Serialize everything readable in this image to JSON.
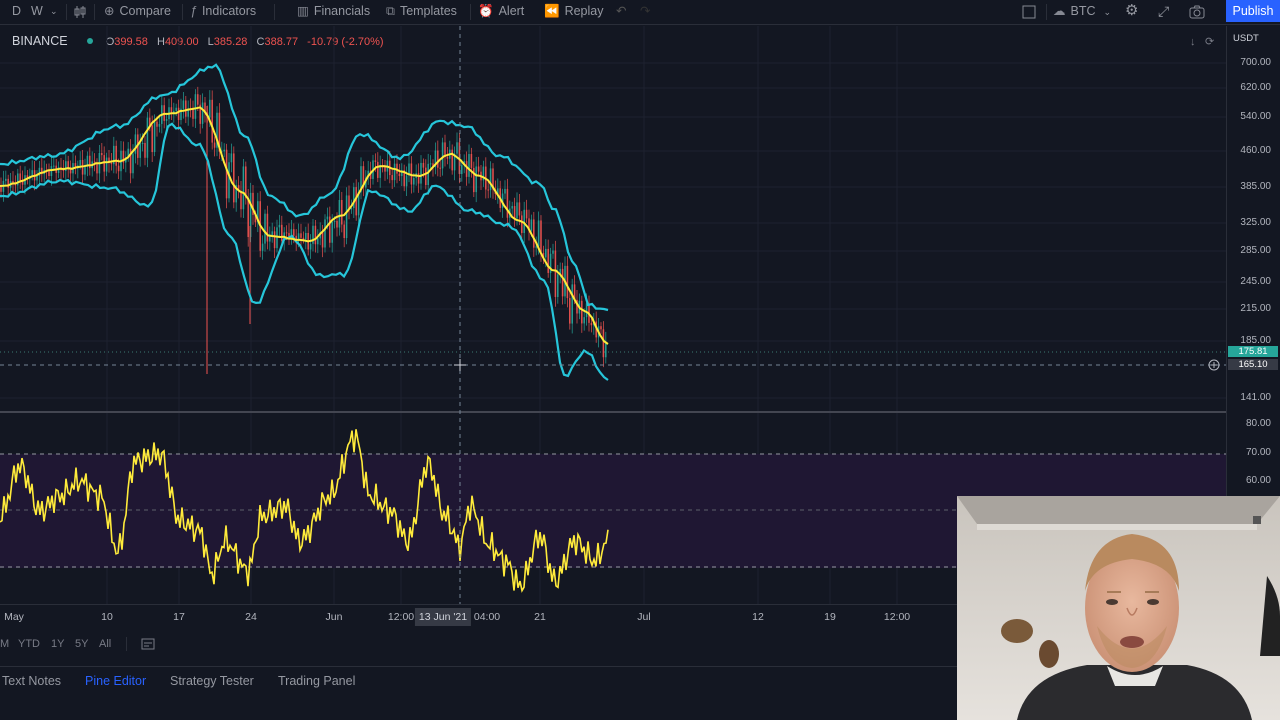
{
  "toolbar": {
    "interval_d": "D",
    "interval_w": "W",
    "compare": "Compare",
    "indicators": "Indicators",
    "financials": "Financials",
    "templates": "Templates",
    "alert": "Alert",
    "replay": "Replay",
    "symbol_btc": "BTC",
    "publish": "Publish"
  },
  "legend": {
    "exchange": "BINANCE",
    "o_label": "O",
    "o_value": "399.58",
    "h_label": "H",
    "h_value": "409.00",
    "l_label": "L",
    "l_value": "385.28",
    "c_label": "C",
    "c_value": "388.77",
    "change": "-10.79 (-2.70%)"
  },
  "price_axis": {
    "currency": "USDT",
    "ticks": [
      "700.00",
      "620.00",
      "540.00",
      "460.00",
      "385.00",
      "325.00",
      "285.00",
      "245.00",
      "215.00",
      "185.00",
      "141.00"
    ],
    "last_price": "175.81",
    "cursor_price": "165.10"
  },
  "rsi_axis": {
    "ticks": [
      "80.00",
      "70.00",
      "60.00"
    ]
  },
  "time_axis": {
    "ticks": [
      "May",
      "10",
      "17",
      "24",
      "Jun",
      "12:00",
      "04:00",
      "21",
      "Jul",
      "12",
      "19",
      "12:00"
    ],
    "cursor_label": "13 Jun '21"
  },
  "range_bar": {
    "m": "M",
    "ytd": "YTD",
    "y1": "1Y",
    "y5": "5Y",
    "all": "All"
  },
  "bottom_panel": {
    "text_notes": "Text Notes",
    "pine_editor": "Pine Editor",
    "strategy_tester": "Strategy Tester",
    "trading_panel": "Trading Panel"
  },
  "colors": {
    "background": "#131722",
    "bollinger": "#26c6da",
    "sma": "#ffeb3b",
    "rsi": "#ffeb3b",
    "rsi_band": "#2a1a4a",
    "candle_up": "#26a69a",
    "candle_down": "#ef5350",
    "accent": "#2962ff"
  }
}
